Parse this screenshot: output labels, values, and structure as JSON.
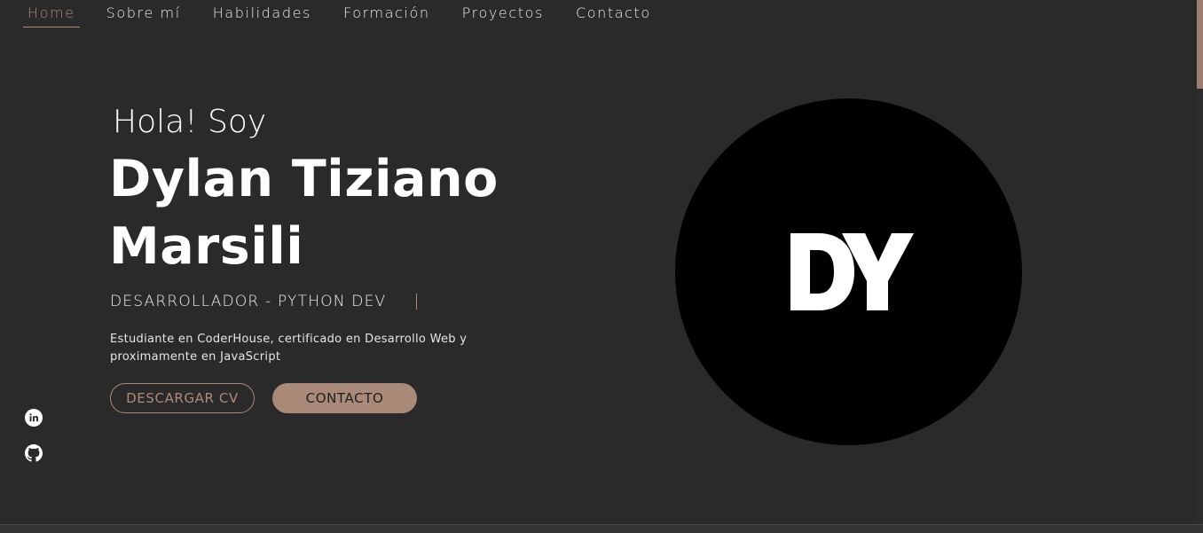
{
  "nav": {
    "items": [
      {
        "label": "Home",
        "active": true
      },
      {
        "label": "Sobre mí",
        "active": false
      },
      {
        "label": "Habilidades",
        "active": false
      },
      {
        "label": "Formación",
        "active": false
      },
      {
        "label": "Proyectos",
        "active": false
      },
      {
        "label": "Contacto",
        "active": false
      }
    ]
  },
  "hero": {
    "greeting": "Hola! Soy",
    "name_line1": "Dylan Tiziano",
    "name_line2": "Marsili",
    "role": "DESARROLLADOR - PYTHON DEV",
    "description": "Estudiante en CoderHouse, certificado en Desarrollo Web y proximamente en JavaScript",
    "buttons": {
      "download_cv": "DESCARGAR CV",
      "contact": "CONTACTO"
    }
  },
  "social": [
    {
      "icon": "linkedin-icon"
    },
    {
      "icon": "github-icon"
    }
  ],
  "logo": {
    "text": "DY"
  },
  "colors": {
    "background": "#2a2a2a",
    "accent": "#b08a78",
    "accent_fill": "#a98a78",
    "text": "#ffffff"
  }
}
